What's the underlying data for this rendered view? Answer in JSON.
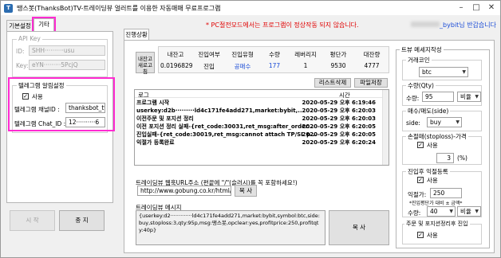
{
  "window": {
    "title": "땡스봇(ThanksBot)TV-트레이딩뷰 얼러트를 이용한 자동매매 무료프로그램",
    "min_icon": "minimize-icon",
    "max_icon": "maximize-icon",
    "close_icon": "close-icon"
  },
  "header": {
    "notice": "* PC절전모드에서는 프로그램이 정상작동 되지 않습니다.",
    "welcome_suffix": "_bybit님 반갑습니다"
  },
  "left_tabs": [
    "기본설정",
    "기타"
  ],
  "api_key": {
    "legend": "API Key",
    "id_label": "ID:",
    "id_value": "SHH··········usu",
    "key_label": "Key:",
    "key_value": "eYN·········5PcjQ"
  },
  "telegram": {
    "legend": "텔레그램 알림설정",
    "use_label": "사용",
    "use_checked": true,
    "channel_label": "텔레그램 채널ID :",
    "channel_value": "thanksbot_tv",
    "chat_label": "텔레그램 Chat_ID :",
    "chat_value": "12··········6"
  },
  "bottom_buttons": {
    "start": "시 작",
    "stop": "종 지"
  },
  "main_tab": "진행상황",
  "stats": {
    "side_label": "내잔고\n새로고침",
    "headers": [
      "내잔고",
      "진입여부",
      "진입유형",
      "수량",
      "레버리지",
      "평단가",
      "대잔량"
    ],
    "values": [
      "0.0196829",
      "진입",
      "공매수",
      "177",
      "1",
      "9530",
      "4777"
    ]
  },
  "log": {
    "clear_button": "리스트삭제",
    "save_button": "파일저장",
    "col_log": "로그",
    "col_time": "시간",
    "rows": [
      {
        "text": "프로그램 시작",
        "time": "2020-05-29 오후 6:19:46"
      },
      {
        "text": "userkey:d2b·········ld4c171fe4add271,market:bybit,...",
        "time": "2020-05-29 오후 6:20:03"
      },
      {
        "text": "이전주문 및 포지션 정리",
        "time": "2020-05-29 오후 6:20:03"
      },
      {
        "text": "이전 포지션 정리 실패-{ret_code:30031,ret_msg:after_order...",
        "time": "2020-05-29 오후 6:20:05"
      },
      {
        "text": "진입실패-{ret_code:30019,ret_msg:cannot attach TP/SL p...",
        "time": "2020-05-29 오후 6:20:05"
      },
      {
        "text": "익절가 등록완료",
        "time": "2020-05-29 오후 6:20:24"
      }
    ]
  },
  "webhook_url": {
    "label": "트레이딩뷰 웹훅URL주소  (편끝에 \"/\"(슬러시)를 꼭 포함하세요!)",
    "value": "http://www.gobung.co.kr/html/tv/",
    "copy_button": "복 사"
  },
  "webhook_message": {
    "label": "트레이딩뷰 메시지",
    "value": "{userkey:d2·············ld4c171fe4add271,market:bybit,symbol:btc,side:buy,stoploss:3,qty:95p,msg:땡스봇,opclear:yes,profitprice:250,profitqty:40p}",
    "copy_button": "복 사"
  },
  "trade_settings": {
    "legend": "트뷰 메세지작성",
    "coin_legend": "거래코인",
    "coin_value": "btc",
    "qty_legend": "수량(Qty)",
    "qty_label": "수량:",
    "qty_value": "95",
    "qty_unit": "비율",
    "side_legend": "매수/매도(side)",
    "side_label": "side:",
    "side_value": "buy",
    "stoploss_legend": "손절매(stoploss)-가격",
    "stoploss_use": "사용",
    "stoploss_checked": true,
    "stoploss_value": "3",
    "stoploss_unit": "(%)",
    "profit_legend": "진입후 익절등록",
    "profit_use": "사용",
    "profit_checked": true,
    "profit_price_label": "익절가:",
    "profit_price_value": "250",
    "profit_note": "*진입평단가 대비 ± 금액*",
    "profit_qty_label": "수량:",
    "profit_qty_value": "40",
    "profit_qty_unit": "비율",
    "opclear_legend": "주문 및 포지션정리후 진입",
    "opclear_use": "사용",
    "opclear_checked": true
  }
}
